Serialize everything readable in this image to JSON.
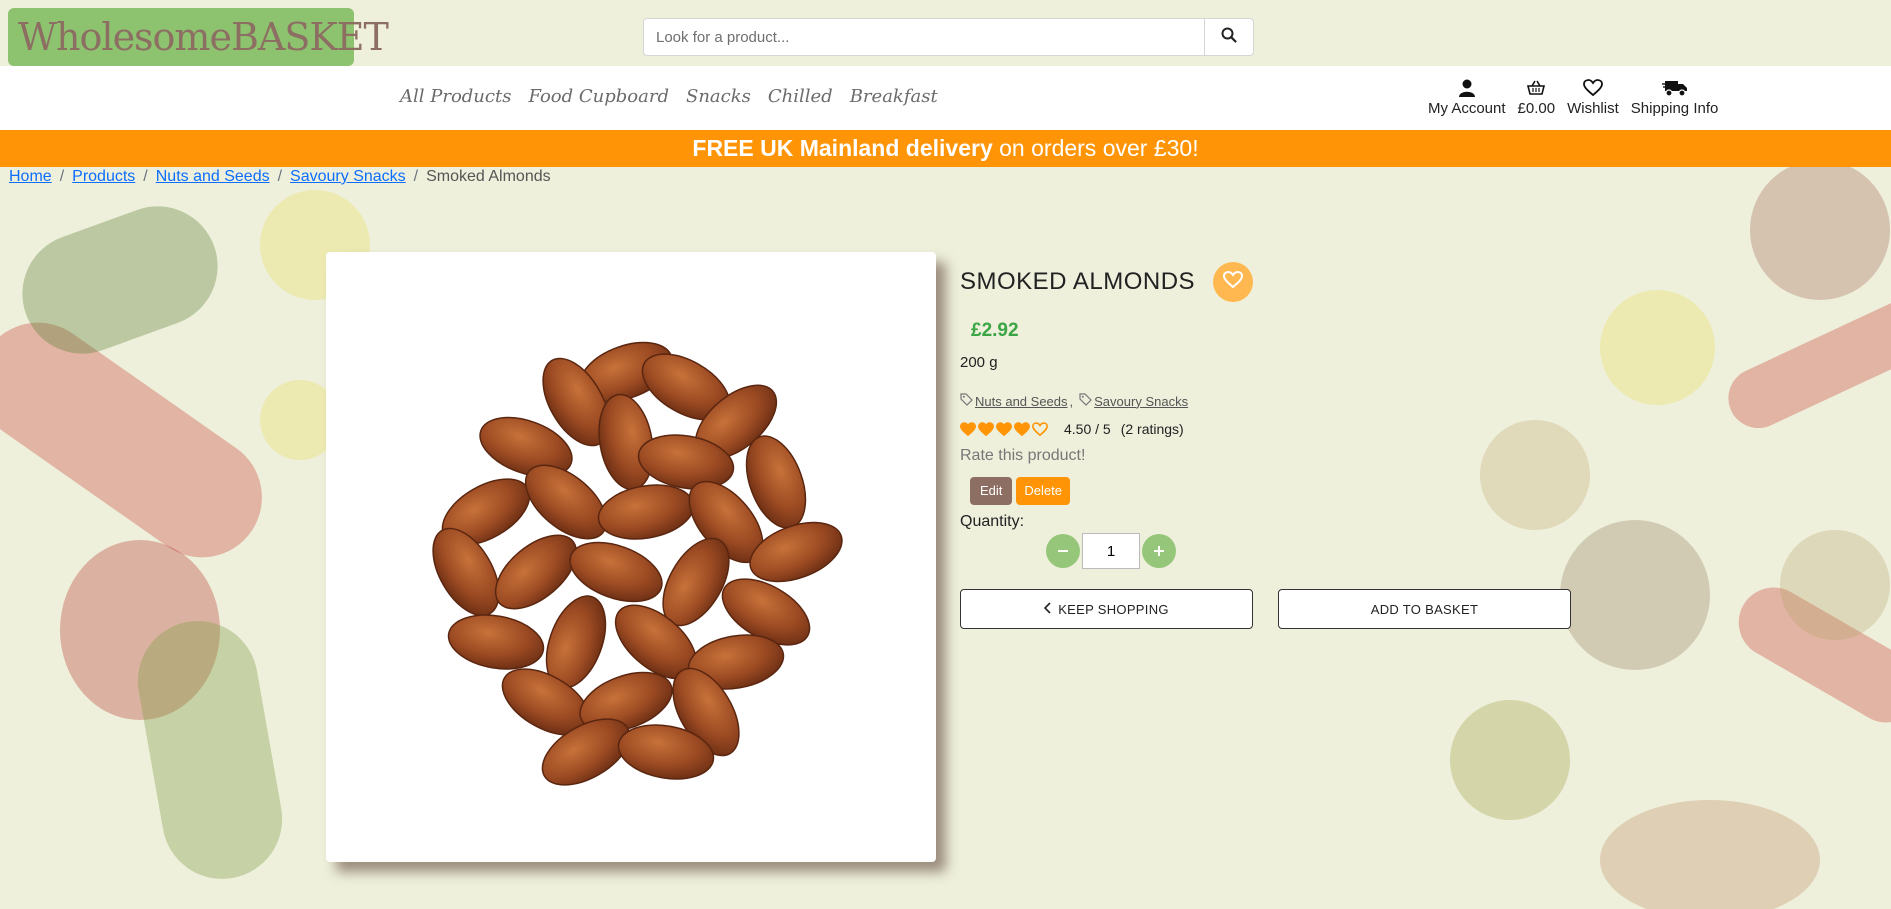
{
  "brand": {
    "logo_text": "WholesomeBASKET"
  },
  "search": {
    "placeholder": "Look for a product..."
  },
  "nav": {
    "links": [
      "All Products",
      "Food Cupboard",
      "Snacks",
      "Chilled",
      "Breakfast"
    ],
    "account": "My Account",
    "basket_total": "£0.00",
    "wishlist": "Wishlist",
    "shipping": "Shipping Info"
  },
  "banner": {
    "bold": "FREE UK Mainland delivery",
    "rest": " on orders over £30!"
  },
  "breadcrumb": {
    "items": [
      "Home",
      "Products",
      "Nuts and Seeds",
      "Savoury Snacks"
    ],
    "separator": "/",
    "current": "Smoked Almonds"
  },
  "product": {
    "title": "SMOKED ALMONDS",
    "price": "£2.92",
    "weight": "200 g",
    "tags": [
      "Nuts and Seeds",
      "Savoury Snacks"
    ],
    "tag_separator": ",",
    "rating_value": 4.5,
    "rating_text": "4.50 / 5",
    "rating_count": "(2 ratings)",
    "rate_prompt": "Rate this product!",
    "edit_label": "Edit",
    "delete_label": "Delete",
    "quantity_label": "Quantity:",
    "quantity_value": "1",
    "keep_shopping": "KEEP SHOPPING",
    "add_to_basket": "ADD TO BASKET"
  },
  "colors": {
    "accent_orange": "#ff9506",
    "logo_green": "#8dc26f",
    "logo_brown": "#8d6e63",
    "price_green": "#3aa545",
    "wish_button": "#ffb850"
  }
}
